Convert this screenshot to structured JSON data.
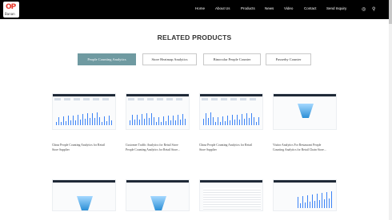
{
  "header": {
    "logo_text": "OP",
    "logo_sub": "Banan",
    "nav": [
      "Home",
      "About Us",
      "Products",
      "News",
      "Video",
      "Contact",
      "Send Inquiry"
    ],
    "globe_icon": "globe-icon",
    "search_icon": "search-icon"
  },
  "section": {
    "title": "RELATED PRODUCTS"
  },
  "tabs": [
    {
      "label": "People Counting Analytics",
      "active": true
    },
    {
      "label": "Store Heatmap Analytics",
      "active": false
    },
    {
      "label": "Binocular People Counter",
      "active": false
    },
    {
      "label": "Passerby Counter",
      "active": false
    }
  ],
  "products_row1": [
    {
      "title_line1": "China People Counting Analytics for Retail",
      "title_line2": "Store Supplier"
    },
    {
      "title_line1": "Customer Traffic Analytics for Retail Store",
      "title_line2": "People Counting Analytics for Retail Store..."
    },
    {
      "title_line1": "China People Counting Analytics for Retail",
      "title_line2": "Store Supplier"
    },
    {
      "title_line1": "Visitor Analytics For Restaurant People",
      "title_line2": "Counting Analytics for Retail Chain Store..."
    }
  ],
  "colors": {
    "accent": "#6f9aa1",
    "header_bg": "#000000",
    "logo_red": "#e63b2e"
  }
}
